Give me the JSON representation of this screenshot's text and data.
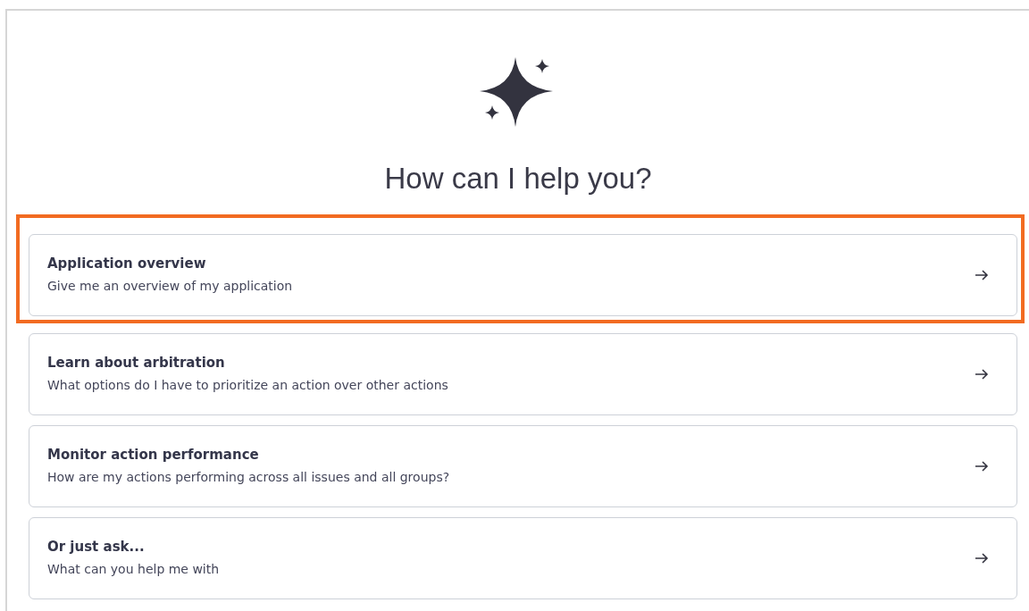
{
  "heading": "How can I help you?",
  "suggestions": [
    {
      "title": "Application overview",
      "description": "Give me an overview of my application",
      "highlighted": true
    },
    {
      "title": "Learn about arbitration",
      "description": "What options do I have to prioritize an action over other actions",
      "highlighted": false
    },
    {
      "title": "Monitor action performance",
      "description": "How are my actions performing across all issues and all groups?",
      "highlighted": false
    },
    {
      "title": "Or just ask...",
      "description": "What can you help me with",
      "highlighted": false
    }
  ]
}
